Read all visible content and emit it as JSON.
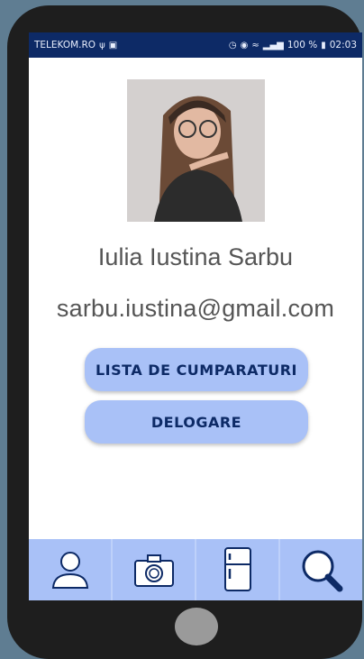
{
  "statusbar": {
    "carrier": "TELEKOM.RO",
    "battery": "100 %",
    "time": "02:03"
  },
  "profile": {
    "name": "Iulia Iustina Sarbu",
    "email": "sarbu.iustina@gmail.com"
  },
  "buttons": {
    "shopping_list": "LISTA DE CUMPARATURI",
    "logout": "DELOGARE"
  },
  "bottom_nav": [
    {
      "icon": "person-icon"
    },
    {
      "icon": "camera-icon"
    },
    {
      "icon": "fridge-icon"
    },
    {
      "icon": "search-icon"
    }
  ],
  "colors": {
    "statusbar_bg": "#0d2a66",
    "accent": "#a9c1f7",
    "button_text": "#0d2a66"
  }
}
